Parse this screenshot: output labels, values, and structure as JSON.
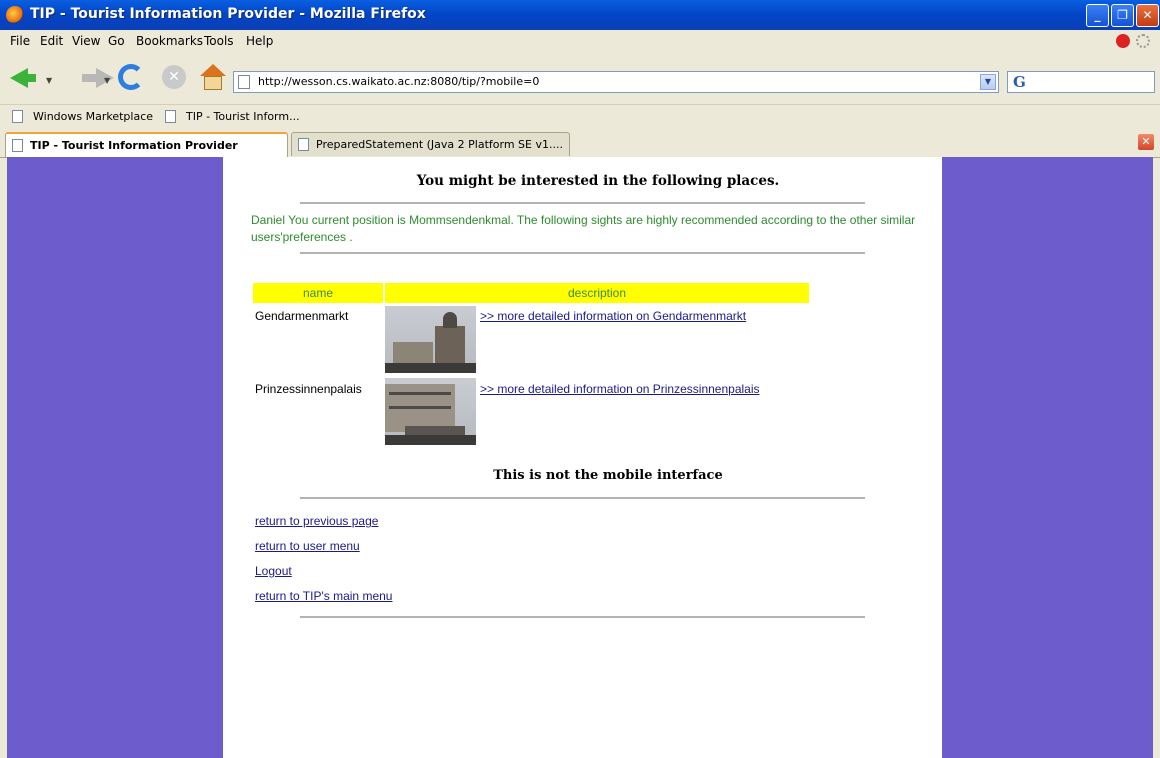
{
  "window": {
    "title": "TIP - Tourist Information Provider - Mozilla Firefox",
    "minimize": "_",
    "maximize": "❐",
    "close": "✕"
  },
  "menubar": {
    "items": [
      "File",
      "Edit",
      "View",
      "Go",
      "Bookmarks",
      "Tools",
      "Help"
    ]
  },
  "navbar": {
    "url": "http://wesson.cs.waikato.ac.nz:8080/tip/?mobile=0",
    "search_placeholder": "",
    "search_icon": "G",
    "url_dropdown_icon": "chevron-down-icon"
  },
  "bookmarks": {
    "items": [
      "Windows Marketplace",
      "TIP - Tourist Inform..."
    ]
  },
  "tabs": [
    {
      "label": "TIP - Tourist Information Provider",
      "active": true
    },
    {
      "label": "PreparedStatement (Java 2 Platform SE v1....",
      "active": false
    }
  ],
  "page": {
    "heading": "You might be interested in the following places.",
    "intro": "Daniel You current position is Mommsendenkmal. The following sights are highly recommended according to the other similar users'preferences .",
    "table": {
      "columns": [
        "name",
        "description"
      ],
      "rows": [
        {
          "name": "Gendarmenmarkt",
          "link": ">> more detailed information on Gendarmenmarkt"
        },
        {
          "name": "Prinzessinnenpalais",
          "link": ">> more detailed information on Prinzessinnenpalais"
        }
      ]
    },
    "not_mobile": "This is not the mobile interface",
    "links": [
      "return to previous page",
      "return to user menu",
      "Logout",
      "return to TIP's main menu"
    ]
  },
  "colors": {
    "side_background": "#6c5ccc",
    "table_header": "#ffff00",
    "intro_text": "#2e8b2e",
    "link": "#1a1a8a"
  }
}
